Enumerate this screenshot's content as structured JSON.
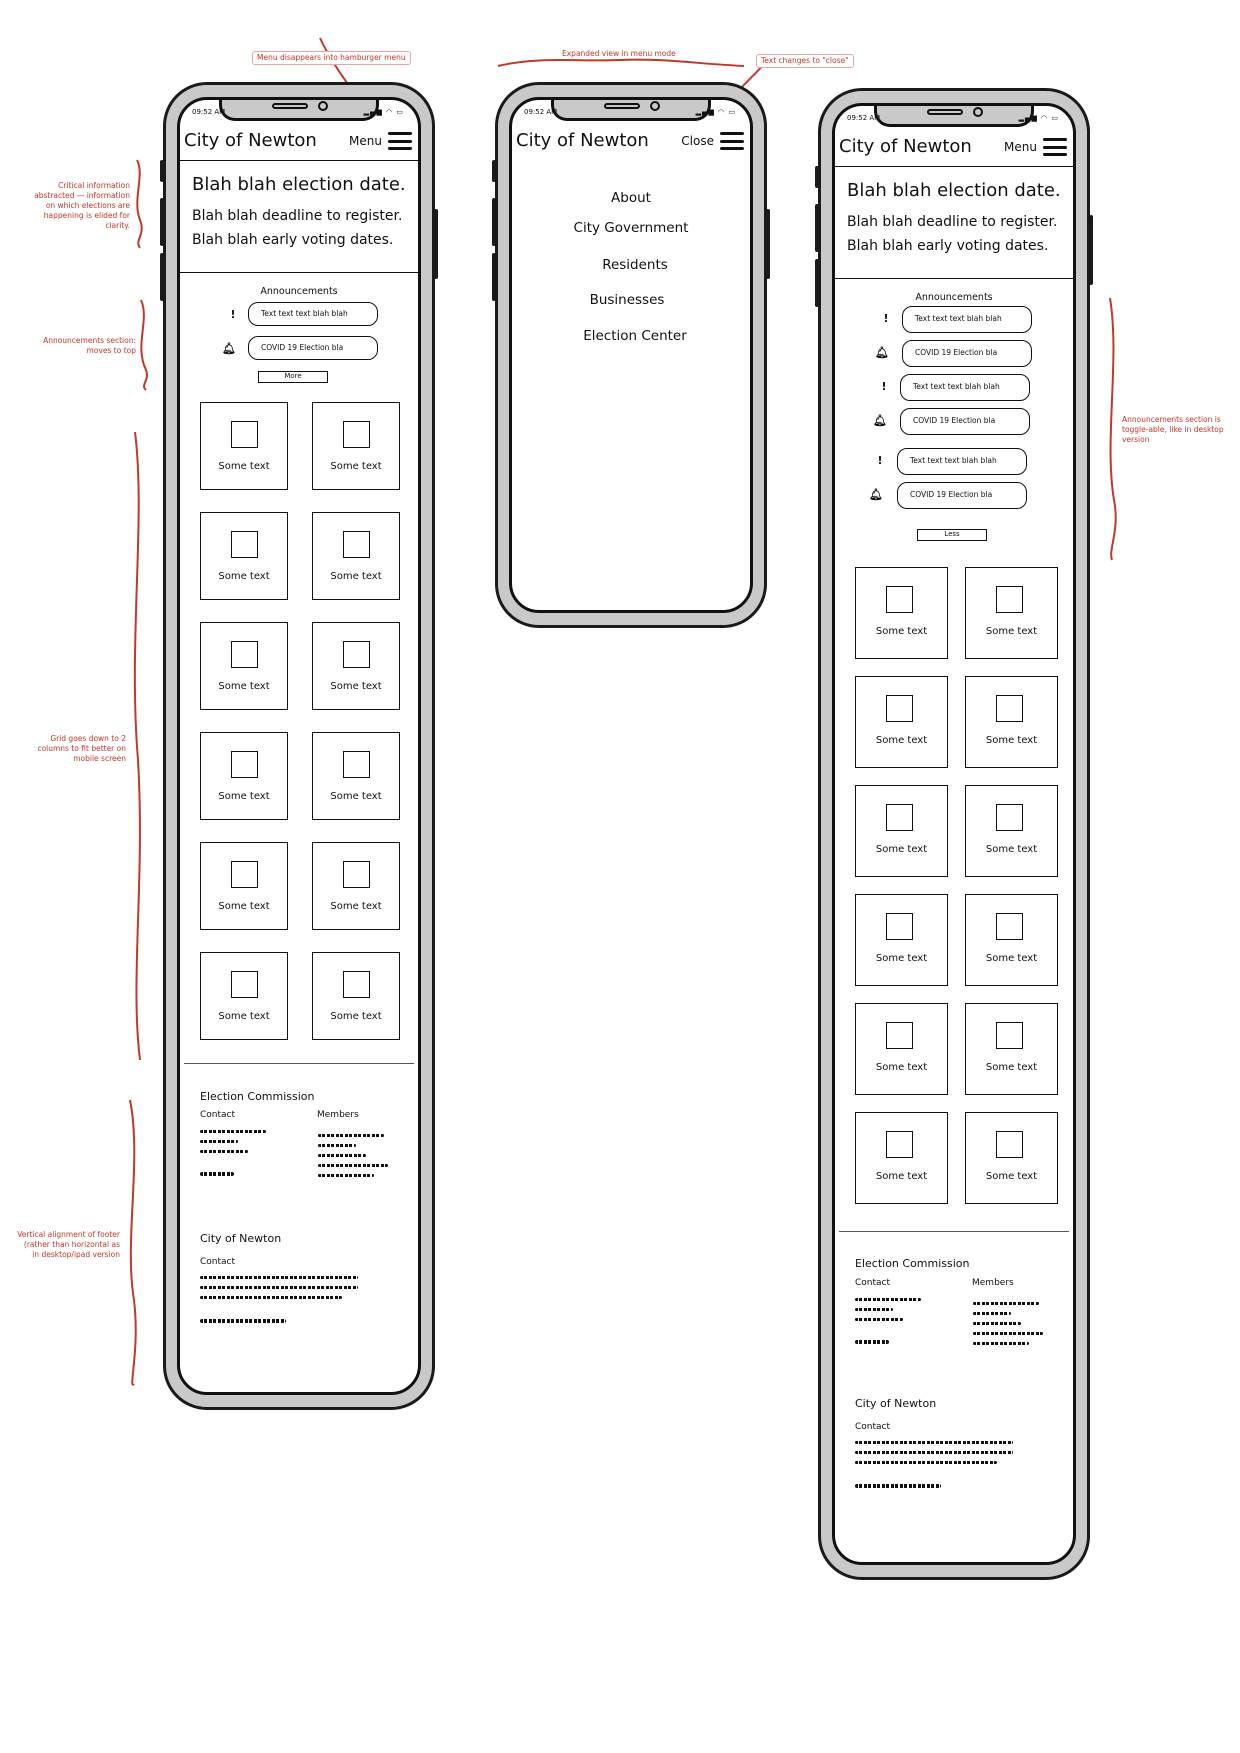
{
  "annotations": {
    "hamburger": "Menu disappears into hamburger menu",
    "expanded": "Expanded view in menu mode",
    "close": "Text changes to \"close\"",
    "critical": "Critical information abstracted — information on which elections are happening is elided for clarity.",
    "announcements_top": "Announcements section: moves to top",
    "grid": "Grid goes down to 2 columns to fit better on mobile screen",
    "footer": "Vertical alignment of footer (rather than horizontal as in desktop/ipad version",
    "toggle": "Announcements section is toggle-able, like in desktop version"
  },
  "status_time": "09:52 AM",
  "site_title": "City of Newton",
  "menu_label": "Menu",
  "close_label": "Close",
  "critical": {
    "headline": "Blah blah election date.",
    "line1": "Blah blah deadline to register.",
    "line2": "Blah blah early voting dates."
  },
  "announcements": {
    "title": "Announcements",
    "items": [
      {
        "icon": "!",
        "text": "Text text text blah blah"
      },
      {
        "icon": "bell",
        "text": "COVID 19 Election bla"
      },
      {
        "icon": "!",
        "text": "Text text text blah blah"
      },
      {
        "icon": "bell",
        "text": "COVID 19 Election bla"
      },
      {
        "icon": "!",
        "text": "Text text text blah blah"
      },
      {
        "icon": "bell",
        "text": "COVID 19 Election bla"
      }
    ],
    "more_label": "More",
    "less_label": "Less"
  },
  "tile_text": "Some text",
  "footer": {
    "commission_title": "Election Commission",
    "contact_label": "Contact",
    "members_label": "Members",
    "city_title": "City of Newton",
    "city_contact_label": "Contact"
  },
  "menu_items": [
    "About",
    "City Government",
    "Residents",
    "Businesses",
    "Election Center"
  ],
  "colors": {
    "annotation": "#c0392b",
    "phone_frame": "#c9c9c9",
    "ink": "#111111"
  }
}
